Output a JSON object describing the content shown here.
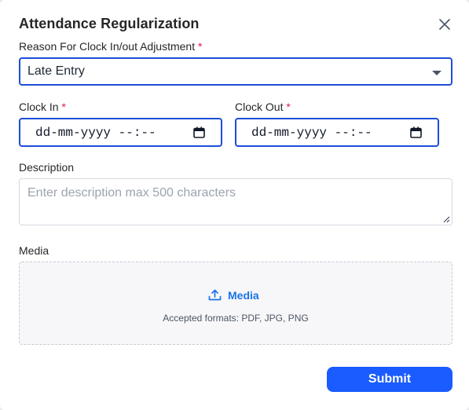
{
  "dialog": {
    "title": "Attendance Regularization"
  },
  "reason": {
    "label": "Reason For Clock In/out Adjustment",
    "required_mark": "*",
    "value": "Late Entry"
  },
  "clock_in": {
    "label": "Clock In",
    "required_mark": "*",
    "value": "dd-mm-yyyy --:--"
  },
  "clock_out": {
    "label": "Clock Out",
    "required_mark": "*",
    "value": "dd-mm-yyyy --:--"
  },
  "description": {
    "label": "Description",
    "placeholder": "Enter description max 500 characters"
  },
  "media": {
    "label": "Media",
    "upload_label": "Media",
    "formats_text": "Accepted formats: PDF, JPG, PNG"
  },
  "actions": {
    "submit_label": "Submit"
  },
  "colors": {
    "accent": "#1a5cff",
    "focus_border": "#1d4ed8",
    "link": "#1a73e8",
    "required": "#e11d48"
  }
}
